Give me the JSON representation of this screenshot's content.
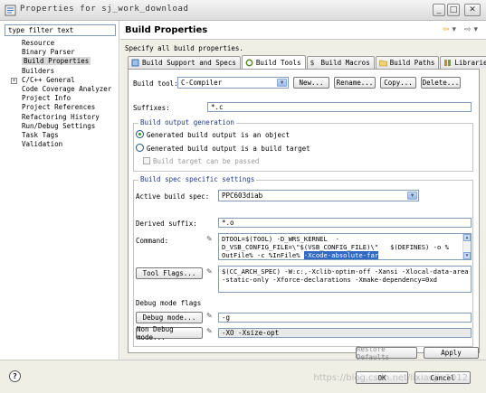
{
  "window": {
    "title": "Properties for sj_work_download"
  },
  "filter": {
    "placeholder": "type filter text"
  },
  "tree": {
    "items": [
      {
        "label": "Resource"
      },
      {
        "label": "Binary Parser"
      },
      {
        "label": "Build Properties",
        "selected": true
      },
      {
        "label": "Builders"
      },
      {
        "label": "C/C++ General",
        "expandable": true
      },
      {
        "label": "Code Coverage Analyzer"
      },
      {
        "label": "Project Info"
      },
      {
        "label": "Project References"
      },
      {
        "label": "Refactoring History"
      },
      {
        "label": "Run/Debug Settings"
      },
      {
        "label": "Task Tags"
      },
      {
        "label": "Validation"
      }
    ]
  },
  "page": {
    "title": "Build Properties",
    "subtitle": "Specify all build properties."
  },
  "tabs": [
    {
      "label": "Build Support and Specs",
      "icon": "build-support-icon"
    },
    {
      "label": "Build Tools",
      "icon": "build-tools-icon",
      "active": true
    },
    {
      "label": "Build Macros",
      "icon": "dollar-icon"
    },
    {
      "label": "Build Paths",
      "icon": "folder-icon"
    },
    {
      "label": "Libraries",
      "icon": "library-icon"
    }
  ],
  "build_tool": {
    "label": "Build tool:",
    "value": "C-Compiler",
    "new_label": "New...",
    "rename_label": "Rename...",
    "copy_label": "Copy...",
    "delete_label": "Delete..."
  },
  "suffixes": {
    "label": "Suffixes:",
    "value": "*.c"
  },
  "output": {
    "group_title": "Build output generation",
    "radio_object": "Generated build output is an object",
    "radio_target": "Generated build output is a build target",
    "check_passed": "Build target can be passed"
  },
  "spec": {
    "group_title": "Build spec specific settings",
    "active_label": "Active build spec:",
    "active_value": "PPC603diab",
    "derived_label": "Derived suffix:",
    "derived_value": "*.o",
    "command_label": "Command:",
    "command_line1": "DTOOL=$(TOOL) -D_WRS_KERNEL  -",
    "command_line2": "D_VSB_CONFIG_FILE=\\\"$(VSB_CONFIG_FILE)\\\"   $(DEFINES) -o %",
    "command_line3_pre": "OutFile% -c %InFile% ",
    "command_line3_hl": "-Xcode-absolute-far",
    "toolflags_label": "Tool Flags...",
    "toolflags_line1": "$(CC_ARCH_SPEC) -W:c:,-Xclib-optim-off -Xansi -Xlocal-data-area",
    "toolflags_line2": "-static-only -Xforce-declarations -Xmake-dependency=0xd"
  },
  "debug": {
    "group_title": "Debug mode flags",
    "debug_label": "Debug mode...",
    "debug_value": "-g",
    "nondebug_label": "Non Debug mode...",
    "nondebug_value": "-XO -Xsize-opt"
  },
  "buttons": {
    "restore": "Restore Defaults",
    "apply": "Apply",
    "ok": "OK",
    "cancel": "Cancel"
  },
  "watermark": "https://blog.csdn.net/lixiaojie1012"
}
